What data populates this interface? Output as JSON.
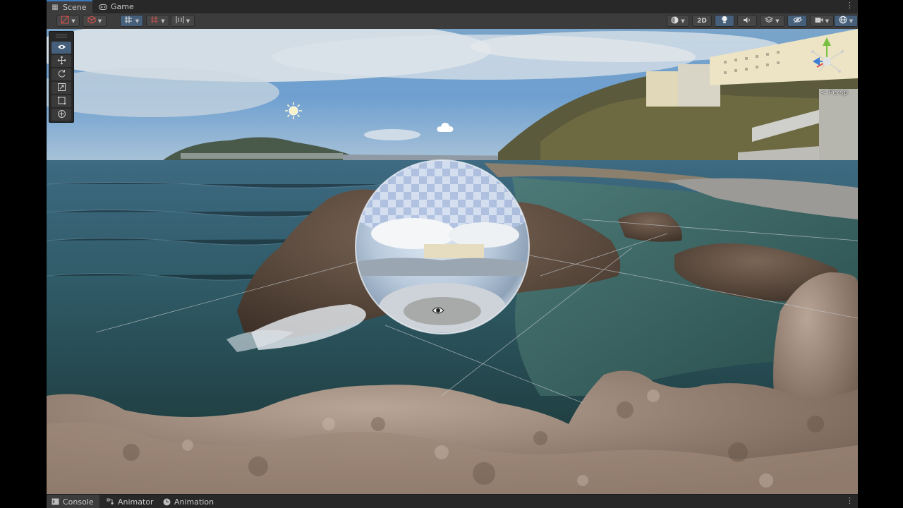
{
  "top_tabs": [
    {
      "label": "Scene",
      "icon": "grid-icon",
      "active": true
    },
    {
      "label": "Game",
      "icon": "gamepad-icon",
      "active": false
    }
  ],
  "toolbar_right": {
    "mode_2d_label": "2D"
  },
  "gizmo": {
    "projection_label": "< Persp"
  },
  "bottom_tabs": [
    {
      "label": "Console",
      "icon": "console-icon",
      "active": true
    },
    {
      "label": "Animator",
      "icon": "animator-icon",
      "active": false
    },
    {
      "label": "Animation",
      "icon": "clock-icon",
      "active": false
    }
  ],
  "colors": {
    "accent": "#3a79bb",
    "panel": "#383838",
    "toolbar": "#3c3c3c",
    "tab_strip": "#282828",
    "active_tool": "#46607c"
  }
}
